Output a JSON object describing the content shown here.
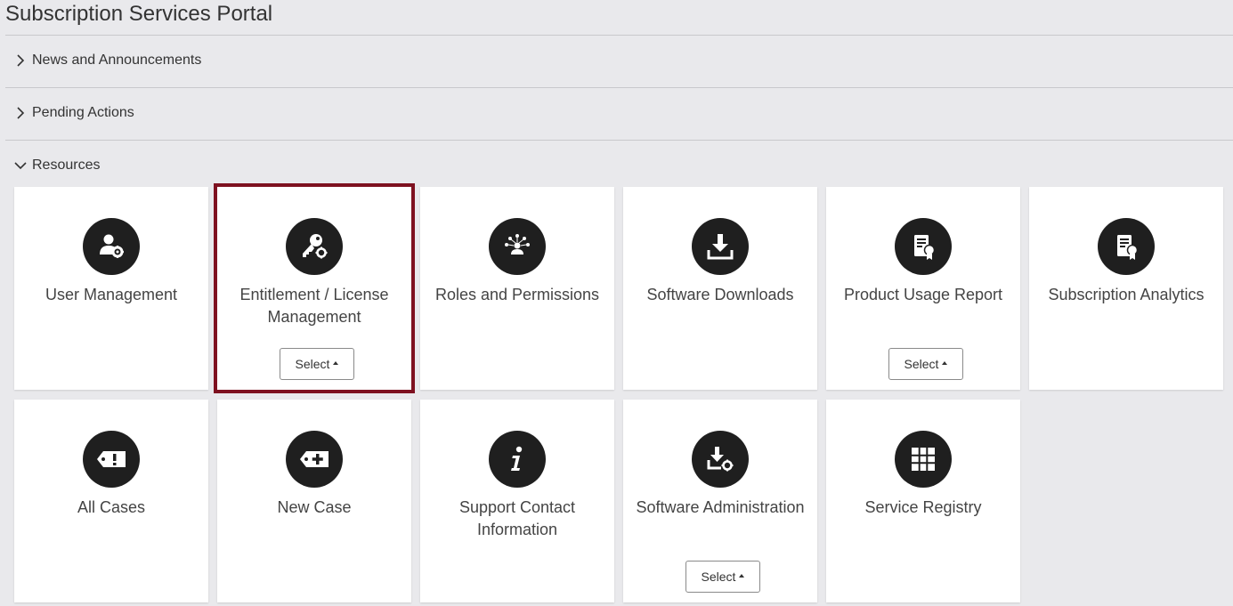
{
  "page": {
    "title": "Subscription Services Portal"
  },
  "sections": [
    {
      "label": "News and Announcements",
      "expanded": false
    },
    {
      "label": "Pending Actions",
      "expanded": false
    },
    {
      "label": "Resources",
      "expanded": true
    }
  ],
  "tiles": [
    {
      "label": "User Management",
      "icon": "user-gear-icon",
      "select": ""
    },
    {
      "label": "Entitlement / License Management",
      "icon": "key-gear-icon",
      "select": "Select",
      "selected": true
    },
    {
      "label": "Roles and Permissions",
      "icon": "people-network-icon",
      "select": ""
    },
    {
      "label": "Software Downloads",
      "icon": "download-icon",
      "select": ""
    },
    {
      "label": "Product Usage Report",
      "icon": "certificate-report-icon",
      "select": "Select"
    },
    {
      "label": "Subscription Analytics",
      "icon": "certificate-report-icon",
      "select": ""
    },
    {
      "label": "All Cases",
      "icon": "ticket-alert-icon",
      "select": ""
    },
    {
      "label": "New Case",
      "icon": "ticket-add-icon",
      "select": ""
    },
    {
      "label": "Support Contact Information",
      "icon": "info-icon",
      "select": ""
    },
    {
      "label": "Software Administration",
      "icon": "download-gear-icon",
      "select": "Select"
    },
    {
      "label": "Service Registry",
      "icon": "grid-icon",
      "select": ""
    }
  ],
  "colors": {
    "selected_outline": "#7e1120",
    "icon_bg": "#1f1f1f"
  }
}
